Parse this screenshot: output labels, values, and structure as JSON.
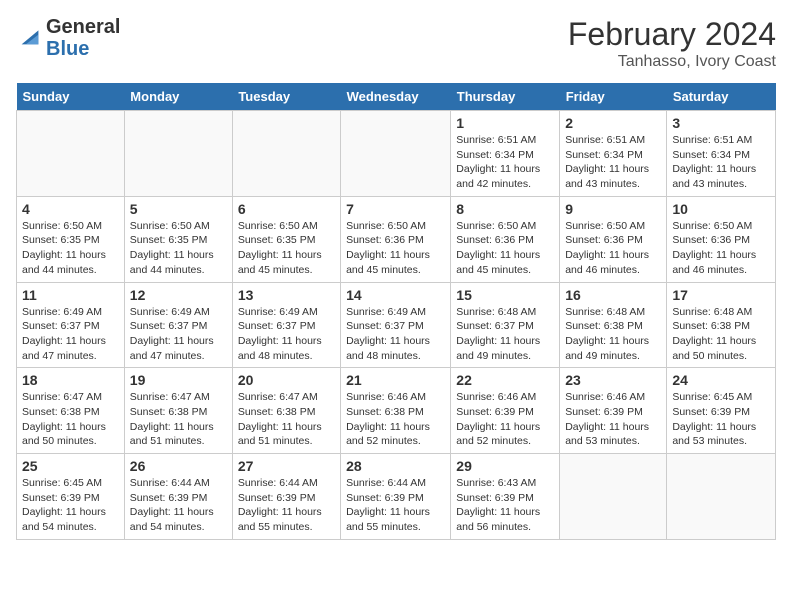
{
  "header": {
    "logo_line1": "General",
    "logo_line2": "Blue",
    "month": "February 2024",
    "location": "Tanhasso, Ivory Coast"
  },
  "days_of_week": [
    "Sunday",
    "Monday",
    "Tuesday",
    "Wednesday",
    "Thursday",
    "Friday",
    "Saturday"
  ],
  "weeks": [
    [
      {
        "day": "",
        "info": ""
      },
      {
        "day": "",
        "info": ""
      },
      {
        "day": "",
        "info": ""
      },
      {
        "day": "",
        "info": ""
      },
      {
        "day": "1",
        "info": "Sunrise: 6:51 AM\nSunset: 6:34 PM\nDaylight: 11 hours and 42 minutes."
      },
      {
        "day": "2",
        "info": "Sunrise: 6:51 AM\nSunset: 6:34 PM\nDaylight: 11 hours and 43 minutes."
      },
      {
        "day": "3",
        "info": "Sunrise: 6:51 AM\nSunset: 6:34 PM\nDaylight: 11 hours and 43 minutes."
      }
    ],
    [
      {
        "day": "4",
        "info": "Sunrise: 6:50 AM\nSunset: 6:35 PM\nDaylight: 11 hours and 44 minutes."
      },
      {
        "day": "5",
        "info": "Sunrise: 6:50 AM\nSunset: 6:35 PM\nDaylight: 11 hours and 44 minutes."
      },
      {
        "day": "6",
        "info": "Sunrise: 6:50 AM\nSunset: 6:35 PM\nDaylight: 11 hours and 45 minutes."
      },
      {
        "day": "7",
        "info": "Sunrise: 6:50 AM\nSunset: 6:36 PM\nDaylight: 11 hours and 45 minutes."
      },
      {
        "day": "8",
        "info": "Sunrise: 6:50 AM\nSunset: 6:36 PM\nDaylight: 11 hours and 45 minutes."
      },
      {
        "day": "9",
        "info": "Sunrise: 6:50 AM\nSunset: 6:36 PM\nDaylight: 11 hours and 46 minutes."
      },
      {
        "day": "10",
        "info": "Sunrise: 6:50 AM\nSunset: 6:36 PM\nDaylight: 11 hours and 46 minutes."
      }
    ],
    [
      {
        "day": "11",
        "info": "Sunrise: 6:49 AM\nSunset: 6:37 PM\nDaylight: 11 hours and 47 minutes."
      },
      {
        "day": "12",
        "info": "Sunrise: 6:49 AM\nSunset: 6:37 PM\nDaylight: 11 hours and 47 minutes."
      },
      {
        "day": "13",
        "info": "Sunrise: 6:49 AM\nSunset: 6:37 PM\nDaylight: 11 hours and 48 minutes."
      },
      {
        "day": "14",
        "info": "Sunrise: 6:49 AM\nSunset: 6:37 PM\nDaylight: 11 hours and 48 minutes."
      },
      {
        "day": "15",
        "info": "Sunrise: 6:48 AM\nSunset: 6:37 PM\nDaylight: 11 hours and 49 minutes."
      },
      {
        "day": "16",
        "info": "Sunrise: 6:48 AM\nSunset: 6:38 PM\nDaylight: 11 hours and 49 minutes."
      },
      {
        "day": "17",
        "info": "Sunrise: 6:48 AM\nSunset: 6:38 PM\nDaylight: 11 hours and 50 minutes."
      }
    ],
    [
      {
        "day": "18",
        "info": "Sunrise: 6:47 AM\nSunset: 6:38 PM\nDaylight: 11 hours and 50 minutes."
      },
      {
        "day": "19",
        "info": "Sunrise: 6:47 AM\nSunset: 6:38 PM\nDaylight: 11 hours and 51 minutes."
      },
      {
        "day": "20",
        "info": "Sunrise: 6:47 AM\nSunset: 6:38 PM\nDaylight: 11 hours and 51 minutes."
      },
      {
        "day": "21",
        "info": "Sunrise: 6:46 AM\nSunset: 6:38 PM\nDaylight: 11 hours and 52 minutes."
      },
      {
        "day": "22",
        "info": "Sunrise: 6:46 AM\nSunset: 6:39 PM\nDaylight: 11 hours and 52 minutes."
      },
      {
        "day": "23",
        "info": "Sunrise: 6:46 AM\nSunset: 6:39 PM\nDaylight: 11 hours and 53 minutes."
      },
      {
        "day": "24",
        "info": "Sunrise: 6:45 AM\nSunset: 6:39 PM\nDaylight: 11 hours and 53 minutes."
      }
    ],
    [
      {
        "day": "25",
        "info": "Sunrise: 6:45 AM\nSunset: 6:39 PM\nDaylight: 11 hours and 54 minutes."
      },
      {
        "day": "26",
        "info": "Sunrise: 6:44 AM\nSunset: 6:39 PM\nDaylight: 11 hours and 54 minutes."
      },
      {
        "day": "27",
        "info": "Sunrise: 6:44 AM\nSunset: 6:39 PM\nDaylight: 11 hours and 55 minutes."
      },
      {
        "day": "28",
        "info": "Sunrise: 6:44 AM\nSunset: 6:39 PM\nDaylight: 11 hours and 55 minutes."
      },
      {
        "day": "29",
        "info": "Sunrise: 6:43 AM\nSunset: 6:39 PM\nDaylight: 11 hours and 56 minutes."
      },
      {
        "day": "",
        "info": ""
      },
      {
        "day": "",
        "info": ""
      }
    ]
  ]
}
